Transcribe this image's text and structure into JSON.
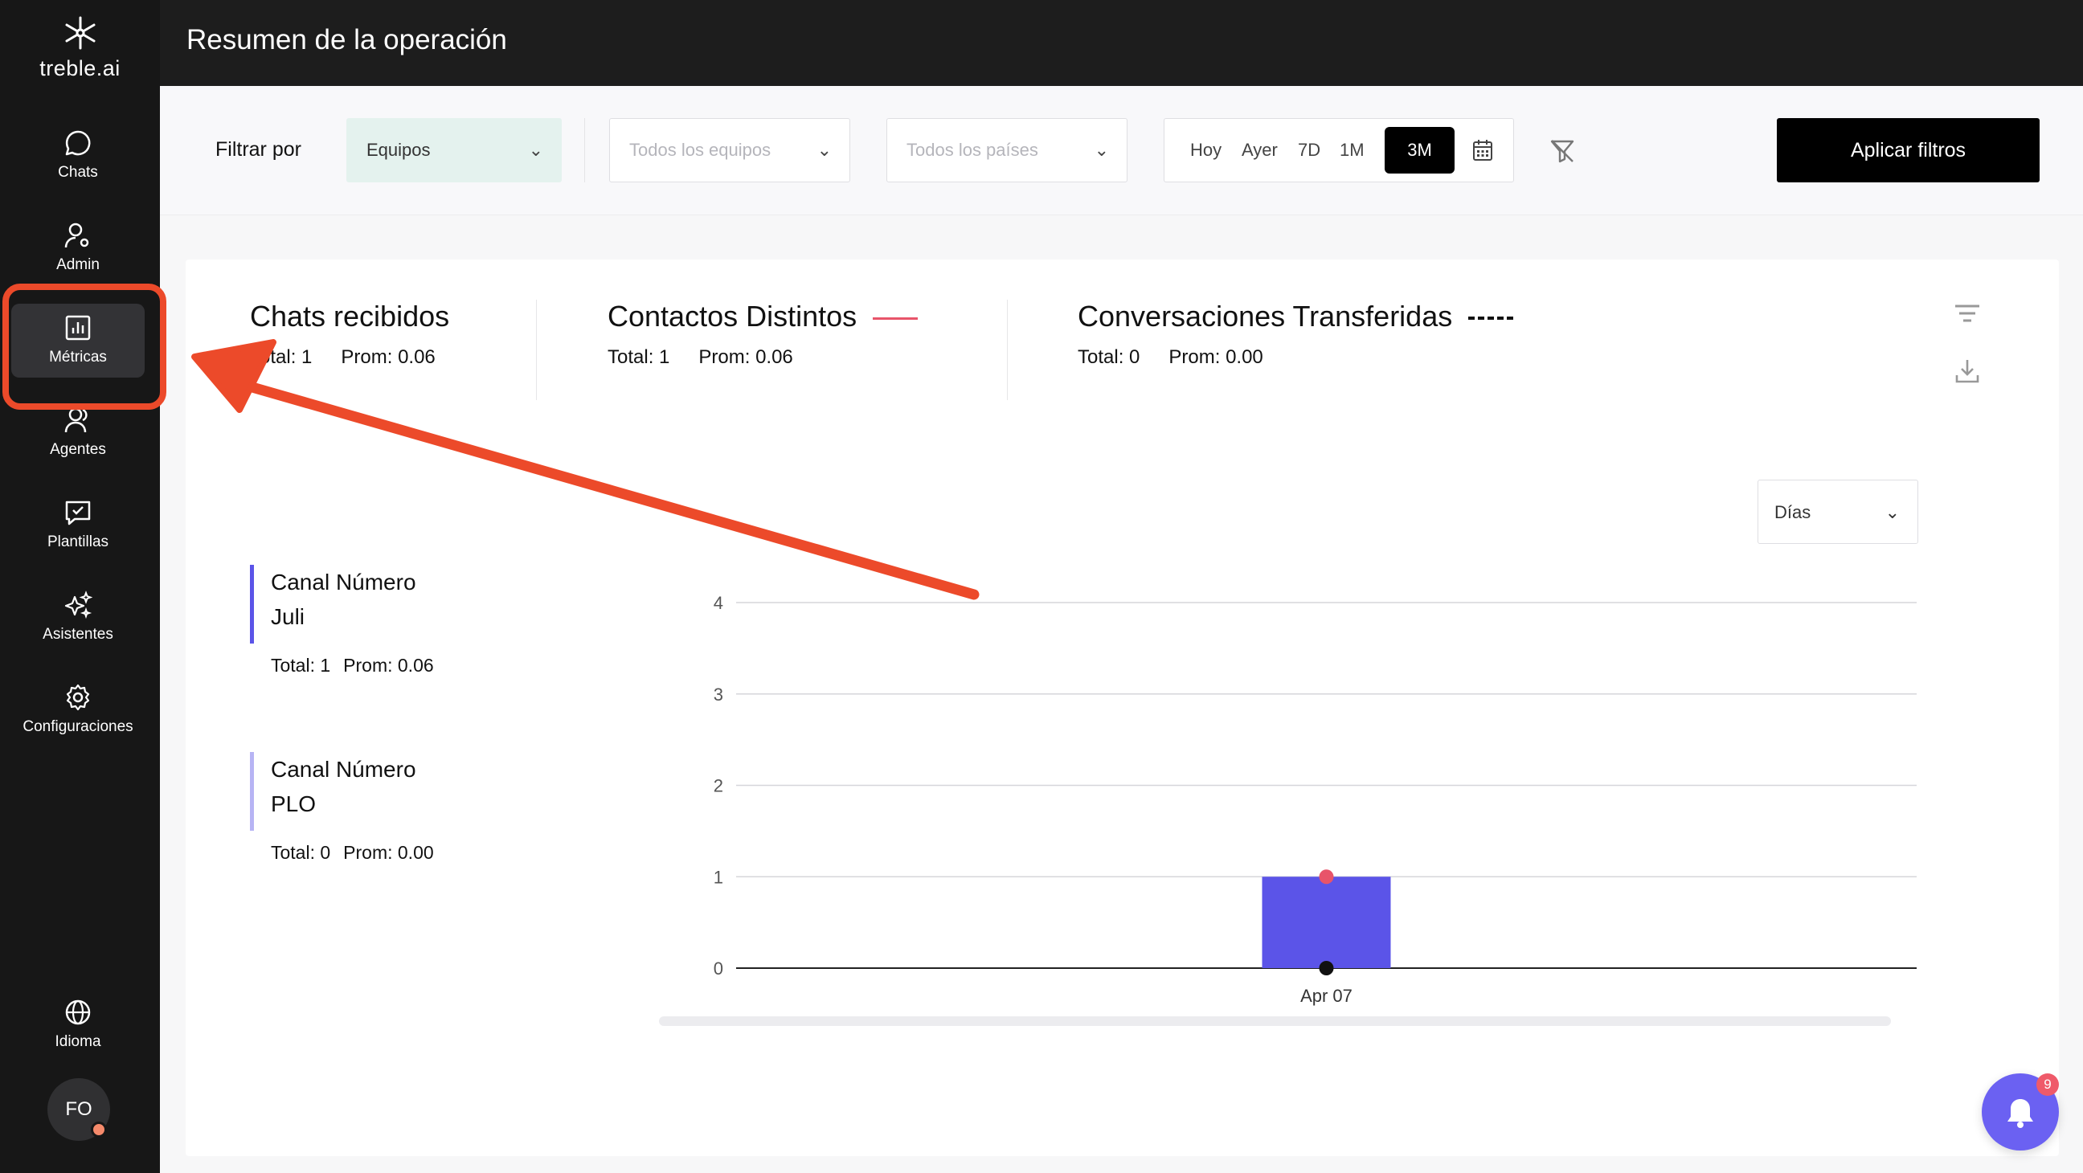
{
  "brand": {
    "logo_text": "treble.ai"
  },
  "sidebar": {
    "items": [
      {
        "label": "Chats",
        "icon": "chat-bubble-icon"
      },
      {
        "label": "Admin",
        "icon": "user-settings-icon"
      },
      {
        "label": "Métricas",
        "icon": "bar-chart-icon",
        "active": true
      },
      {
        "label": "Agentes",
        "icon": "users-icon"
      },
      {
        "label": "Plantillas",
        "icon": "template-check-icon"
      },
      {
        "label": "Asistentes",
        "icon": "sparkles-icon"
      },
      {
        "label": "Configuraciones",
        "icon": "gear-icon"
      }
    ],
    "language": {
      "label": "Idioma",
      "icon": "globe-icon"
    },
    "avatar_initials": "FO"
  },
  "header": {
    "title": "Resumen de la operación"
  },
  "filters": {
    "label": "Filtrar por",
    "group_by": "Equipos",
    "teams_placeholder": "Todos los equipos",
    "countries_placeholder": "Todos los países",
    "ranges": [
      "Hoy",
      "Ayer",
      "7D",
      "1M",
      "3M"
    ],
    "selected_range": "3M",
    "apply_label": "Aplicar filtros"
  },
  "metrics": [
    {
      "title": "Chats recibidos",
      "total": "Total: 1",
      "avg": "Prom: 0.06"
    },
    {
      "title": "Contactos Distintos",
      "total": "Total: 1",
      "avg": "Prom: 0.06",
      "line_color": "#e8546a"
    },
    {
      "title": "Conversaciones Transferidas",
      "total": "Total: 0",
      "avg": "Prom: 0.00",
      "line_style": "dashed"
    }
  ],
  "granularity": "Días",
  "legend": [
    {
      "name": "Canal Número Juli",
      "total": "Total: 1",
      "avg": "Prom: 0.06",
      "color": "#5b54e8"
    },
    {
      "name": "Canal Número PLO",
      "total": "Total: 0",
      "avg": "Prom: 0.00",
      "color": "#b7b4f4"
    }
  ],
  "chart_data": {
    "type": "bar",
    "categories": [
      "Apr 07"
    ],
    "series": [
      {
        "name": "Canal Número Juli",
        "values": [
          1
        ],
        "color": "#5b54e8"
      },
      {
        "name": "Canal Número PLO",
        "values": [
          0
        ],
        "color": "#b7b4f4"
      },
      {
        "name": "Contactos Distintos",
        "values": [
          1
        ],
        "color": "#e8546a",
        "kind": "point"
      },
      {
        "name": "Conversaciones Transferidas",
        "values": [
          0
        ],
        "color": "#111111",
        "kind": "point"
      }
    ],
    "yticks": [
      0,
      1,
      2,
      3,
      4
    ],
    "ylim": [
      0,
      4
    ],
    "grid": true
  },
  "notifications": {
    "count": "9"
  },
  "colors": {
    "accent": "#6b61f2",
    "annotation": "#ec4a2a",
    "sidebar_bg": "#171717"
  }
}
